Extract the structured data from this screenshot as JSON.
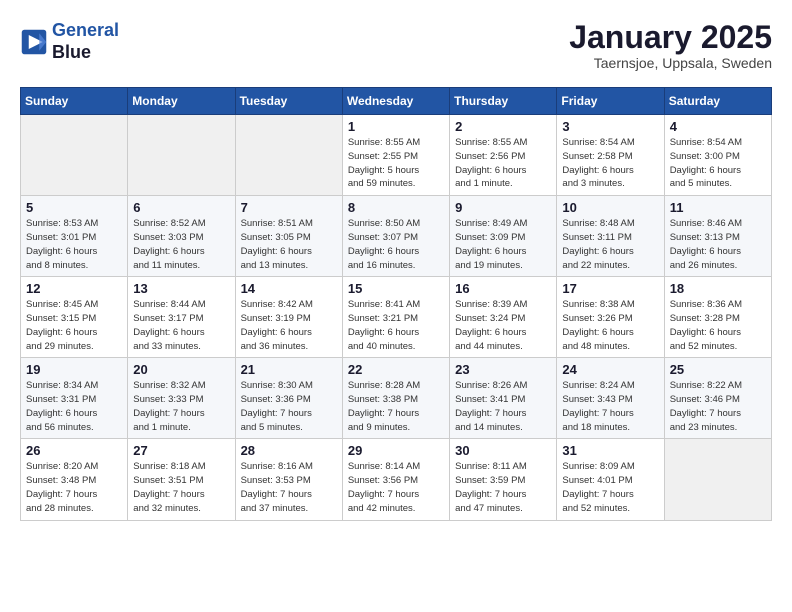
{
  "logo": {
    "line1": "General",
    "line2": "Blue"
  },
  "title": "January 2025",
  "subtitle": "Taernsjoe, Uppsala, Sweden",
  "days_header": [
    "Sunday",
    "Monday",
    "Tuesday",
    "Wednesday",
    "Thursday",
    "Friday",
    "Saturday"
  ],
  "weeks": [
    [
      {
        "num": "",
        "detail": ""
      },
      {
        "num": "",
        "detail": ""
      },
      {
        "num": "",
        "detail": ""
      },
      {
        "num": "1",
        "detail": "Sunrise: 8:55 AM\nSunset: 2:55 PM\nDaylight: 5 hours\nand 59 minutes."
      },
      {
        "num": "2",
        "detail": "Sunrise: 8:55 AM\nSunset: 2:56 PM\nDaylight: 6 hours\nand 1 minute."
      },
      {
        "num": "3",
        "detail": "Sunrise: 8:54 AM\nSunset: 2:58 PM\nDaylight: 6 hours\nand 3 minutes."
      },
      {
        "num": "4",
        "detail": "Sunrise: 8:54 AM\nSunset: 3:00 PM\nDaylight: 6 hours\nand 5 minutes."
      }
    ],
    [
      {
        "num": "5",
        "detail": "Sunrise: 8:53 AM\nSunset: 3:01 PM\nDaylight: 6 hours\nand 8 minutes."
      },
      {
        "num": "6",
        "detail": "Sunrise: 8:52 AM\nSunset: 3:03 PM\nDaylight: 6 hours\nand 11 minutes."
      },
      {
        "num": "7",
        "detail": "Sunrise: 8:51 AM\nSunset: 3:05 PM\nDaylight: 6 hours\nand 13 minutes."
      },
      {
        "num": "8",
        "detail": "Sunrise: 8:50 AM\nSunset: 3:07 PM\nDaylight: 6 hours\nand 16 minutes."
      },
      {
        "num": "9",
        "detail": "Sunrise: 8:49 AM\nSunset: 3:09 PM\nDaylight: 6 hours\nand 19 minutes."
      },
      {
        "num": "10",
        "detail": "Sunrise: 8:48 AM\nSunset: 3:11 PM\nDaylight: 6 hours\nand 22 minutes."
      },
      {
        "num": "11",
        "detail": "Sunrise: 8:46 AM\nSunset: 3:13 PM\nDaylight: 6 hours\nand 26 minutes."
      }
    ],
    [
      {
        "num": "12",
        "detail": "Sunrise: 8:45 AM\nSunset: 3:15 PM\nDaylight: 6 hours\nand 29 minutes."
      },
      {
        "num": "13",
        "detail": "Sunrise: 8:44 AM\nSunset: 3:17 PM\nDaylight: 6 hours\nand 33 minutes."
      },
      {
        "num": "14",
        "detail": "Sunrise: 8:42 AM\nSunset: 3:19 PM\nDaylight: 6 hours\nand 36 minutes."
      },
      {
        "num": "15",
        "detail": "Sunrise: 8:41 AM\nSunset: 3:21 PM\nDaylight: 6 hours\nand 40 minutes."
      },
      {
        "num": "16",
        "detail": "Sunrise: 8:39 AM\nSunset: 3:24 PM\nDaylight: 6 hours\nand 44 minutes."
      },
      {
        "num": "17",
        "detail": "Sunrise: 8:38 AM\nSunset: 3:26 PM\nDaylight: 6 hours\nand 48 minutes."
      },
      {
        "num": "18",
        "detail": "Sunrise: 8:36 AM\nSunset: 3:28 PM\nDaylight: 6 hours\nand 52 minutes."
      }
    ],
    [
      {
        "num": "19",
        "detail": "Sunrise: 8:34 AM\nSunset: 3:31 PM\nDaylight: 6 hours\nand 56 minutes."
      },
      {
        "num": "20",
        "detail": "Sunrise: 8:32 AM\nSunset: 3:33 PM\nDaylight: 7 hours\nand 1 minute."
      },
      {
        "num": "21",
        "detail": "Sunrise: 8:30 AM\nSunset: 3:36 PM\nDaylight: 7 hours\nand 5 minutes."
      },
      {
        "num": "22",
        "detail": "Sunrise: 8:28 AM\nSunset: 3:38 PM\nDaylight: 7 hours\nand 9 minutes."
      },
      {
        "num": "23",
        "detail": "Sunrise: 8:26 AM\nSunset: 3:41 PM\nDaylight: 7 hours\nand 14 minutes."
      },
      {
        "num": "24",
        "detail": "Sunrise: 8:24 AM\nSunset: 3:43 PM\nDaylight: 7 hours\nand 18 minutes."
      },
      {
        "num": "25",
        "detail": "Sunrise: 8:22 AM\nSunset: 3:46 PM\nDaylight: 7 hours\nand 23 minutes."
      }
    ],
    [
      {
        "num": "26",
        "detail": "Sunrise: 8:20 AM\nSunset: 3:48 PM\nDaylight: 7 hours\nand 28 minutes."
      },
      {
        "num": "27",
        "detail": "Sunrise: 8:18 AM\nSunset: 3:51 PM\nDaylight: 7 hours\nand 32 minutes."
      },
      {
        "num": "28",
        "detail": "Sunrise: 8:16 AM\nSunset: 3:53 PM\nDaylight: 7 hours\nand 37 minutes."
      },
      {
        "num": "29",
        "detail": "Sunrise: 8:14 AM\nSunset: 3:56 PM\nDaylight: 7 hours\nand 42 minutes."
      },
      {
        "num": "30",
        "detail": "Sunrise: 8:11 AM\nSunset: 3:59 PM\nDaylight: 7 hours\nand 47 minutes."
      },
      {
        "num": "31",
        "detail": "Sunrise: 8:09 AM\nSunset: 4:01 PM\nDaylight: 7 hours\nand 52 minutes."
      },
      {
        "num": "",
        "detail": ""
      }
    ]
  ]
}
